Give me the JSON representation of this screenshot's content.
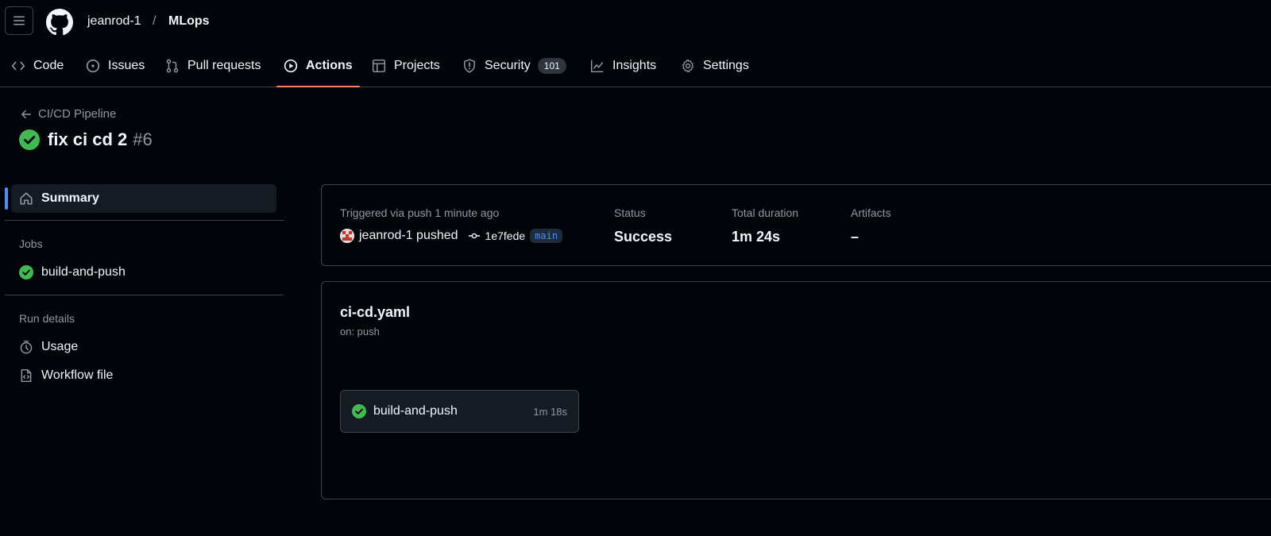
{
  "header": {
    "owner": "jeanrod-1",
    "separator": "/",
    "repo": "MLops"
  },
  "tabs": [
    {
      "label": "Code",
      "icon": "code-icon"
    },
    {
      "label": "Issues",
      "icon": "issue-icon"
    },
    {
      "label": "Pull requests",
      "icon": "pull-request-icon"
    },
    {
      "label": "Actions",
      "icon": "play-icon",
      "active": true
    },
    {
      "label": "Projects",
      "icon": "table-icon"
    },
    {
      "label": "Security",
      "icon": "shield-icon",
      "counter": "101"
    },
    {
      "label": "Insights",
      "icon": "graph-icon"
    },
    {
      "label": "Settings",
      "icon": "gear-icon"
    }
  ],
  "run": {
    "workflow_name": "CI/CD Pipeline",
    "title": "fix ci cd 2",
    "number": "#6",
    "status_icon": "check-circle-icon"
  },
  "sidebar": {
    "summary_label": "Summary",
    "jobs_heading": "Jobs",
    "jobs": [
      {
        "label": "build-and-push",
        "status": "success"
      }
    ],
    "run_details_heading": "Run details",
    "usage_label": "Usage",
    "workflow_file_label": "Workflow file"
  },
  "summary": {
    "trigger_label": "Triggered via push 1 minute ago",
    "actor_text": "jeanrod-1 pushed",
    "commit_sha": "1e7fede",
    "branch": "main",
    "status_label": "Status",
    "status_value": "Success",
    "duration_label": "Total duration",
    "duration_value": "1m 24s",
    "artifacts_label": "Artifacts",
    "artifacts_value": "–"
  },
  "workflow_graph": {
    "file": "ci-cd.yaml",
    "trigger": "on: push",
    "jobs": [
      {
        "name": "build-and-push",
        "duration": "1m 18s",
        "status": "success"
      }
    ]
  },
  "colors": {
    "background": "#010409",
    "success": "#3fb950",
    "accent_underline": "#f78166",
    "link": "#4493f8"
  }
}
